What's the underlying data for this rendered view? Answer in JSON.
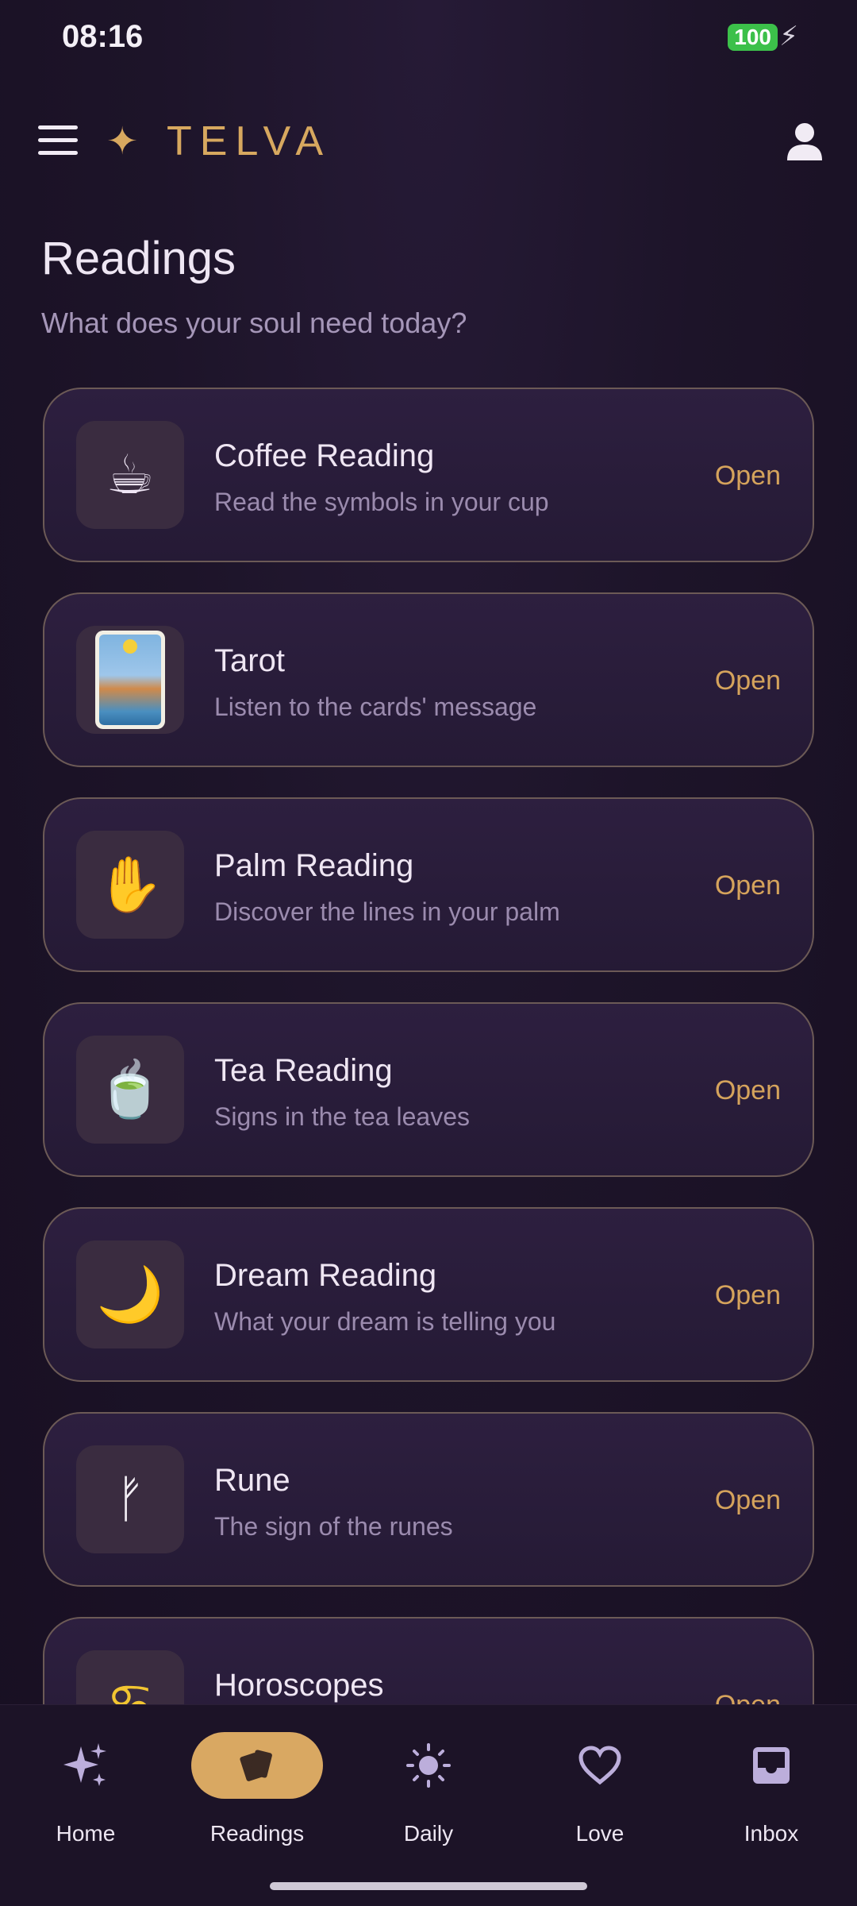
{
  "status_bar": {
    "time": "08:16",
    "battery": "100"
  },
  "app_bar": {
    "logo_text": "TELVA"
  },
  "page": {
    "title": "Readings",
    "subtitle": "What does your soul need today?"
  },
  "readings": [
    {
      "title": "Coffee Reading",
      "description": "Read the symbols in your cup",
      "action": "Open",
      "icon": "☕",
      "icon_name": "coffee-cup-icon"
    },
    {
      "title": "Tarot",
      "description": "Listen to the cards' message",
      "action": "Open",
      "icon": "",
      "icon_name": "tarot-card-icon"
    },
    {
      "title": "Palm Reading",
      "description": "Discover the lines in your palm",
      "action": "Open",
      "icon": "✋",
      "icon_name": "palm-hand-icon"
    },
    {
      "title": "Tea Reading",
      "description": "Signs in the tea leaves",
      "action": "Open",
      "icon": "🍵",
      "icon_name": "tea-cup-icon"
    },
    {
      "title": "Dream Reading",
      "description": "What your dream is telling you",
      "action": "Open",
      "icon": "🌙",
      "icon_name": "crescent-moon-icon"
    },
    {
      "title": "Rune",
      "description": "The sign of the runes",
      "action": "Open",
      "icon": "ᚠ",
      "icon_name": "rune-icon"
    },
    {
      "title": "Horoscopes",
      "description": "",
      "action": "Open",
      "icon": "♋",
      "icon_name": "zodiac-icon"
    }
  ],
  "bottom_nav": [
    {
      "label": "Home",
      "icon_name": "sparkles-icon",
      "active": false
    },
    {
      "label": "Readings",
      "icon_name": "cards-icon",
      "active": true
    },
    {
      "label": "Daily",
      "icon_name": "sun-icon",
      "active": false
    },
    {
      "label": "Love",
      "icon_name": "heart-icon",
      "active": false
    },
    {
      "label": "Inbox",
      "icon_name": "inbox-icon",
      "active": false
    }
  ],
  "colors": {
    "accent_gold": "#d7a85f",
    "background": "#1d1429",
    "card_border": "#6c5a56",
    "muted_text": "#9b8bae"
  }
}
